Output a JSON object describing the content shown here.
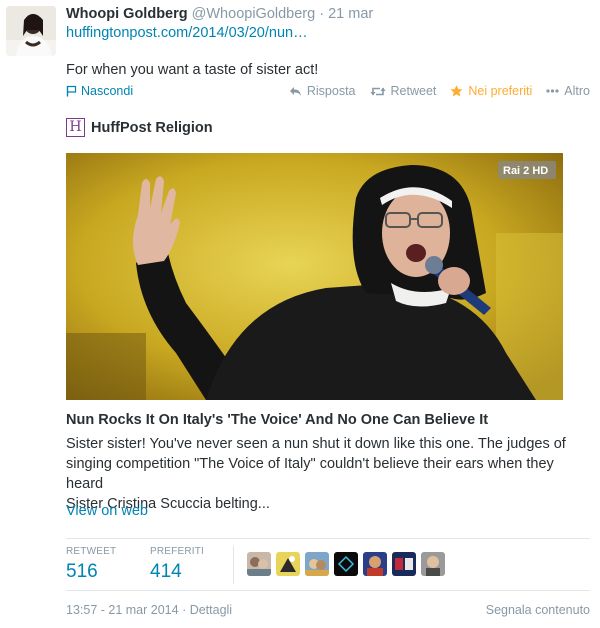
{
  "tweet": {
    "name": "Whoopi Goldberg",
    "handle": "@WhoopiGoldberg",
    "time": "· 21 mar",
    "link": "huffingtonpost.com/2014/03/20/nun…",
    "text": "For when you want a taste of sister act!"
  },
  "actions": {
    "hide": "Nascondi",
    "reply": "Risposta",
    "retweet": "Retweet",
    "favorite": "Nei preferiti",
    "more": "Altro"
  },
  "card": {
    "source_logo": "H",
    "source": "HuffPost Religion",
    "image_badge": "Rai 2 HD",
    "title": "Nun Rocks It On Italy's 'The Voice' And No One Can Believe It",
    "desc_line1": "Sister sister! You've never seen a nun shut it down like this one. The judges of",
    "desc_line2": "singing competition \"The Voice of Italy\" couldn't believe their ears when they heard",
    "desc_line3": "Sister Cristina Scuccia belting...",
    "view_on_web": "View on web"
  },
  "stats": {
    "retweet_label": "RETWEET",
    "retweet_count": "516",
    "favorites_label": "PREFERITI",
    "favorites_count": "414"
  },
  "footer": {
    "timestamp": "13:57 - 21 mar 2014",
    "details": "· Dettagli",
    "report": "Segnala contenuto"
  },
  "colors": {
    "link": "#0084b4",
    "muted": "#8899a6",
    "favorite": "#ffac33",
    "text": "#292f33"
  },
  "icons": [
    "flag-icon",
    "reply-icon",
    "retweet-icon",
    "star-icon",
    "more-dots-icon",
    "huffpost-logo-icon"
  ]
}
